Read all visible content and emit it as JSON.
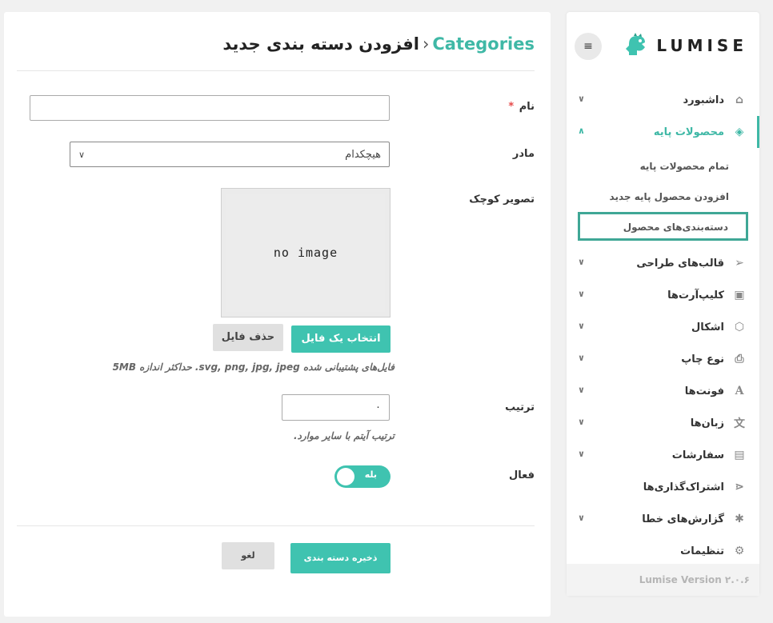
{
  "sidebar": {
    "logo_text": "LUMISE",
    "menu_icon": "hamburger-icon",
    "items": [
      {
        "label": "داشبورد",
        "icon": "home-icon",
        "has_chevron": true
      },
      {
        "label": "محصولات پایه",
        "icon": "cube-icon",
        "has_chevron": true,
        "active": true
      },
      {
        "label": "قالب‌های طراحی",
        "icon": "paper-plane-icon",
        "has_chevron": true
      },
      {
        "label": "کلیپ‌آرت‌ها",
        "icon": "image-icon",
        "has_chevron": true
      },
      {
        "label": "اشکال",
        "icon": "box-icon",
        "has_chevron": true
      },
      {
        "label": "نوع چاپ",
        "icon": "printer-icon",
        "has_chevron": true
      },
      {
        "label": "فونت‌ها",
        "icon": "font-icon",
        "has_chevron": true
      },
      {
        "label": "زبان‌ها",
        "icon": "language-icon",
        "has_chevron": true
      },
      {
        "label": "سفارشات",
        "icon": "bag-icon",
        "has_chevron": true
      },
      {
        "label": "اشتراک‌گذاری‌ها",
        "icon": "share-icon",
        "has_chevron": false
      },
      {
        "label": "گزارش‌های خطا",
        "icon": "bug-icon",
        "has_chevron": true
      },
      {
        "label": "تنظیمات",
        "icon": "gear-icon",
        "has_chevron": false
      }
    ],
    "submenu": [
      {
        "label": "تمام محصولات پایه"
      },
      {
        "label": "افزودن محصول پایه جدید"
      },
      {
        "label": "دسته‌بندی‌های محصول",
        "selected": true
      }
    ],
    "version": "Lumise Version ۲.۰.۶"
  },
  "main": {
    "breadcrumb": "Categories",
    "breadcrumb_sep": "‹",
    "title": "افزودن دسته بندی جدید",
    "form": {
      "name_label": "نام",
      "required_mark": "*",
      "name_value": "",
      "parent_label": "مادر",
      "parent_selected": "هیچکدام",
      "thumbnail_label": "تصویر کوچک",
      "no_image_text": "no image",
      "choose_file_label": "انتخاب یک فایل",
      "remove_file_label": "حذف فایل",
      "file_hint": "فایل‌های پشتیبانی شده svg, png, jpg, jpeg. حداکثر اندازه 5MB",
      "order_label": "ترتیب",
      "order_value": "۰",
      "order_hint": "ترتیب آیتم با سایر موارد.",
      "active_label": "فعال",
      "active_toggle_text": "بله",
      "active_on": true,
      "save_label": "ذخیره دسته بندی",
      "cancel_label": "لغو"
    }
  },
  "colors": {
    "accent": "#3fb8a6",
    "button": "#3fc3b0",
    "selected_border": "#3fa796"
  }
}
